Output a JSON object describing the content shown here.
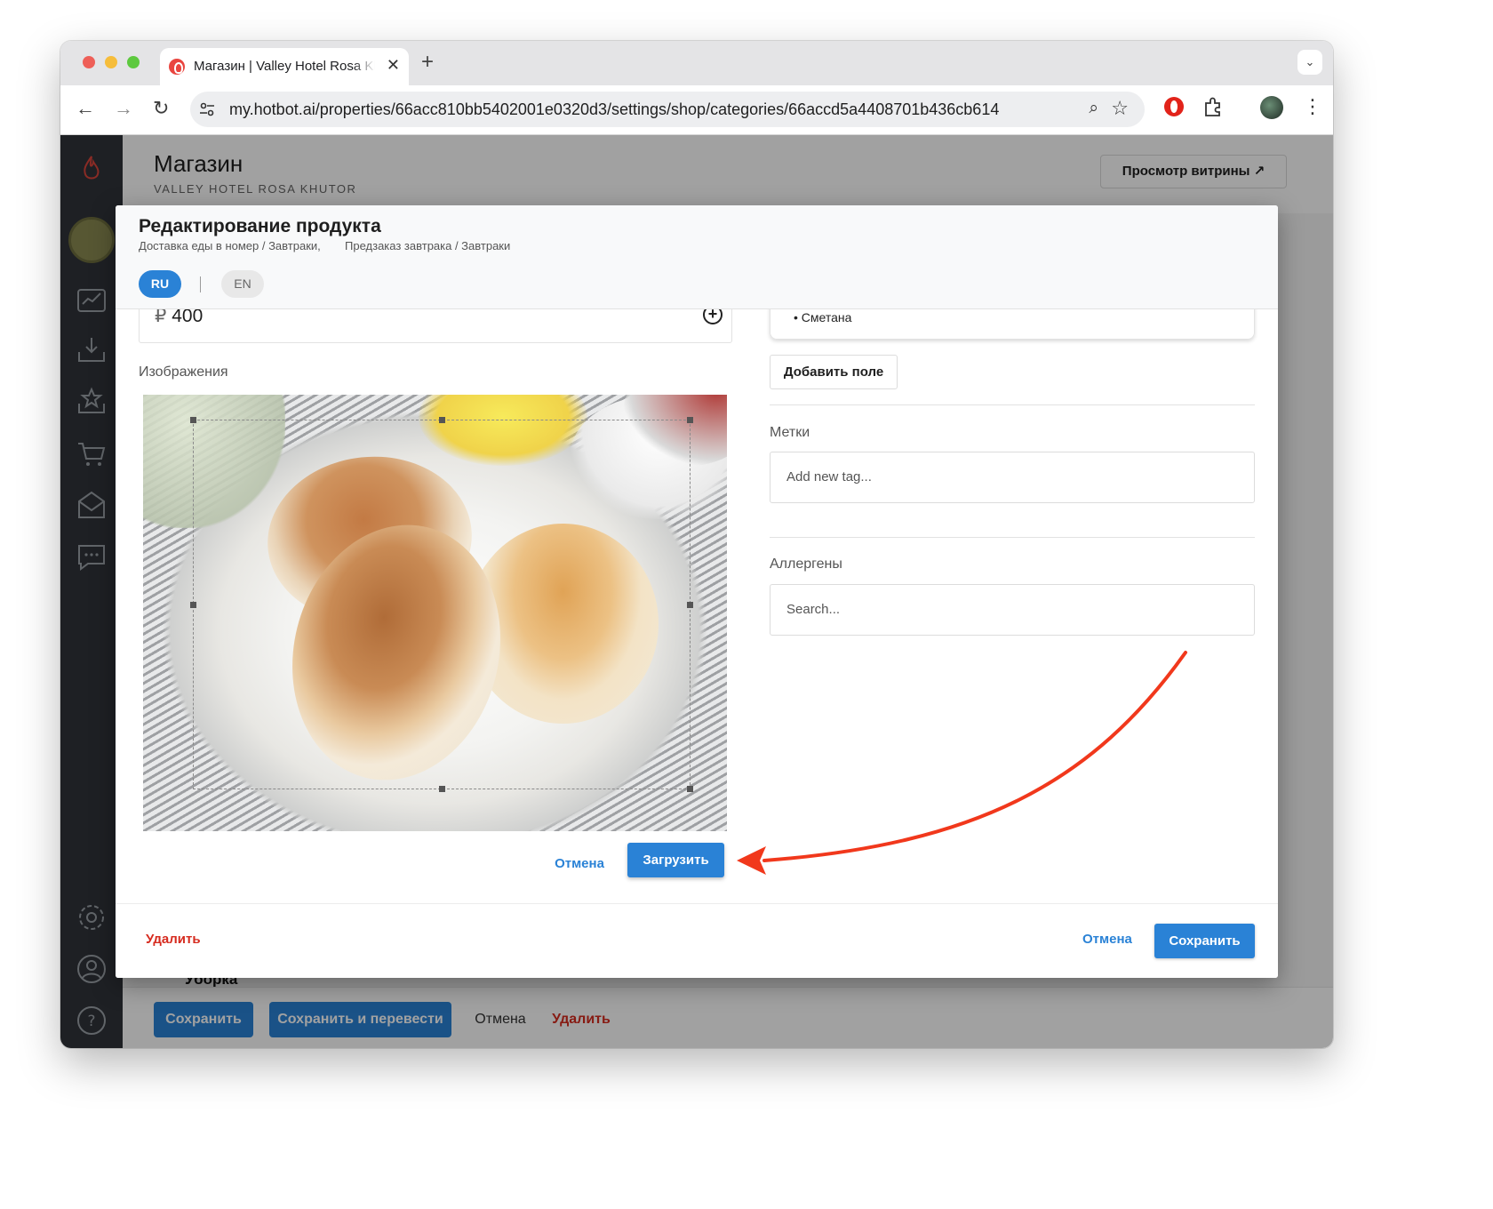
{
  "browser": {
    "tab_title": "Магазин | Valley Hotel Rosa Khutor",
    "tab_close": "✕",
    "new_tab": "+",
    "url": "my.hotbot.ai/properties/66acc810bb5402001e0320d3/settings/shop/categories/66accd5a4408701b436cb614"
  },
  "page": {
    "title": "Магазин",
    "subtitle": "VALLEY HOTEL ROSA KHUTOR",
    "preview_button": "Просмотр витрины ↗",
    "background_row": "Уборка"
  },
  "bottom_bar": {
    "save": "Сохранить",
    "save_translate": "Сохранить и перевести",
    "cancel": "Отмена",
    "delete": "Удалить"
  },
  "modal": {
    "title": "Редактирование продукта",
    "breadcrumbs": [
      "Доставка еды в номер / Завтраки,",
      "Предзаказ завтрака / Завтраки"
    ],
    "languages": [
      "RU",
      "EN"
    ],
    "active_language": "RU",
    "price": {
      "currency": "₽",
      "value": "400"
    },
    "images_label": "Изображения",
    "crop_cancel": "Отмена",
    "crop_upload": "Загрузить",
    "ingredient_item": "• Сметана",
    "add_field": "Добавить поле",
    "tags_label": "Метки",
    "tags_placeholder": "Add new tag...",
    "allergens_label": "Аллергены",
    "allergens_placeholder": "Search...",
    "footer": {
      "delete": "Удалить",
      "cancel": "Отмена",
      "save": "Сохранить"
    }
  },
  "colors": {
    "accent": "#2a82d6",
    "danger": "#d62b1f",
    "sidebar": "#30333a",
    "annotation_arrow": "#f1381c"
  }
}
